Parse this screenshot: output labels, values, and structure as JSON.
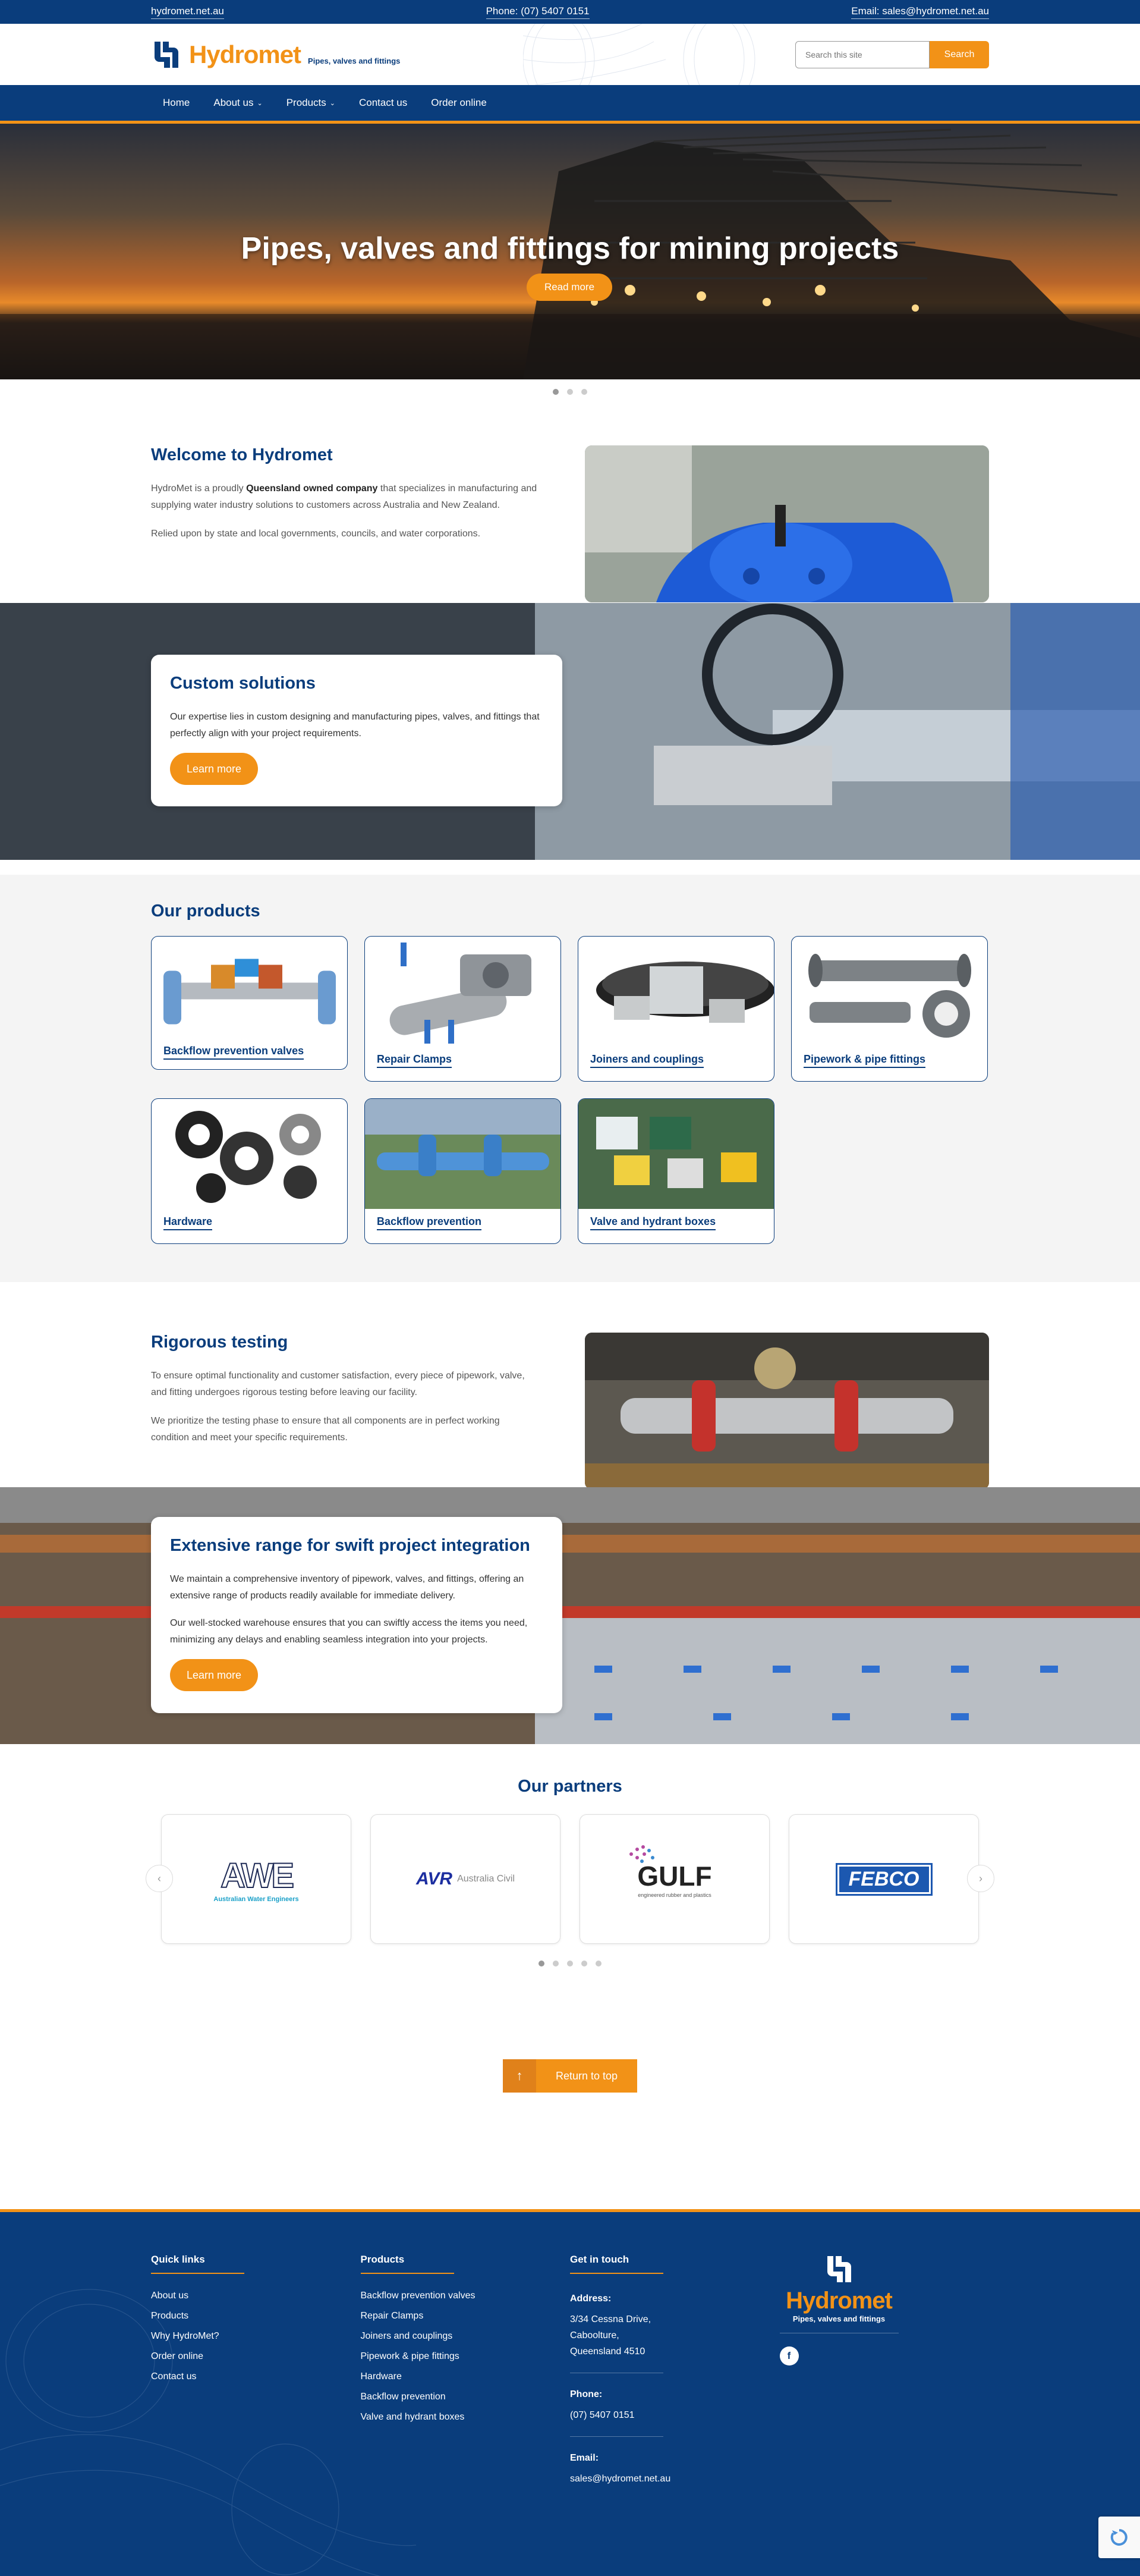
{
  "topbar": {
    "site": "hydromet.net.au",
    "phone": "Phone: (07) 5407 0151",
    "email": "Email: sales@hydromet.net.au"
  },
  "header": {
    "logo_text": "Hydromet",
    "tagline": "Pipes, valves and fittings",
    "search_placeholder": "Search this site",
    "search_button": "Search"
  },
  "nav": {
    "items": [
      "Home",
      "About us",
      "Products",
      "Contact us",
      "Order online"
    ]
  },
  "hero": {
    "title": "Pipes, valves and fittings for mining projects",
    "button": "Read more"
  },
  "welcome": {
    "title": "Welcome to Hydromet",
    "p1_a": "HydroMet is a proudly ",
    "p1_b": "Queensland owned company",
    "p1_c": " that specializes in manufacturing and supplying water industry solutions to customers across Australia and New Zealand.",
    "p2": "Relied upon by state and local governments, councils, and water corporations."
  },
  "custom": {
    "title": "Custom solutions",
    "text": "Our expertise lies in custom designing and manufacturing pipes, valves, and fittings that perfectly align with your project requirements.",
    "button": "Learn more"
  },
  "products": {
    "title": "Our products",
    "items": [
      "Backflow prevention valves",
      "Repair Clamps",
      "Joiners and couplings",
      "Pipework & pipe fittings",
      "Hardware",
      "Backflow prevention",
      "Valve and hydrant boxes"
    ]
  },
  "testing": {
    "title": "Rigorous testing",
    "p1": "To ensure optimal functionality and customer satisfaction, every piece of pipework, valve, and fitting undergoes rigorous testing before leaving our facility.",
    "p2": "We prioritize the testing phase to ensure that all components are in perfect working condition and meet your specific requirements."
  },
  "range": {
    "title": "Extensive range for swift project integration",
    "p1": "We maintain a comprehensive inventory of pipework, valves, and fittings, offering an extensive range of products readily available for immediate delivery.",
    "p2": "Our well-stocked warehouse ensures that you can swiftly access the items you need, minimizing any delays and enabling seamless integration into your projects.",
    "button": "Learn more"
  },
  "partners": {
    "title": "Our partners",
    "logos": [
      {
        "name": "AWE",
        "sub": "Australian Water Engineers"
      },
      {
        "name": "AVR",
        "sub": "Australia Civil"
      },
      {
        "name": "GULF",
        "sub": "engineered rubber and plastics"
      },
      {
        "name": "FEBCO",
        "sub": ""
      }
    ]
  },
  "return_top": "Return to top",
  "footer": {
    "quick_title": "Quick links",
    "quick": [
      "About us",
      "Products",
      "Why HydroMet?",
      "Order online",
      "Contact us"
    ],
    "products_title": "Products",
    "products": [
      "Backflow prevention valves",
      "Repair Clamps",
      "Joiners and couplings",
      "Pipework & pipe fittings",
      "Hardware",
      "Backflow prevention",
      "Valve and hydrant boxes"
    ],
    "contact_title": "Get in touch",
    "address_label": "Address:",
    "address": [
      "3/34 Cessna Drive,",
      "Caboolture,",
      "Queensland 4510"
    ],
    "phone_label": "Phone:",
    "phone": "(07) 5407 0151",
    "email_label": "Email:",
    "email": "sales@hydromet.net.au",
    "logo_text": "Hydromet",
    "tagline": "Pipes, valves and fittings"
  },
  "colors": {
    "brand_blue": "#0a3d7c",
    "brand_orange": "#f29217"
  }
}
